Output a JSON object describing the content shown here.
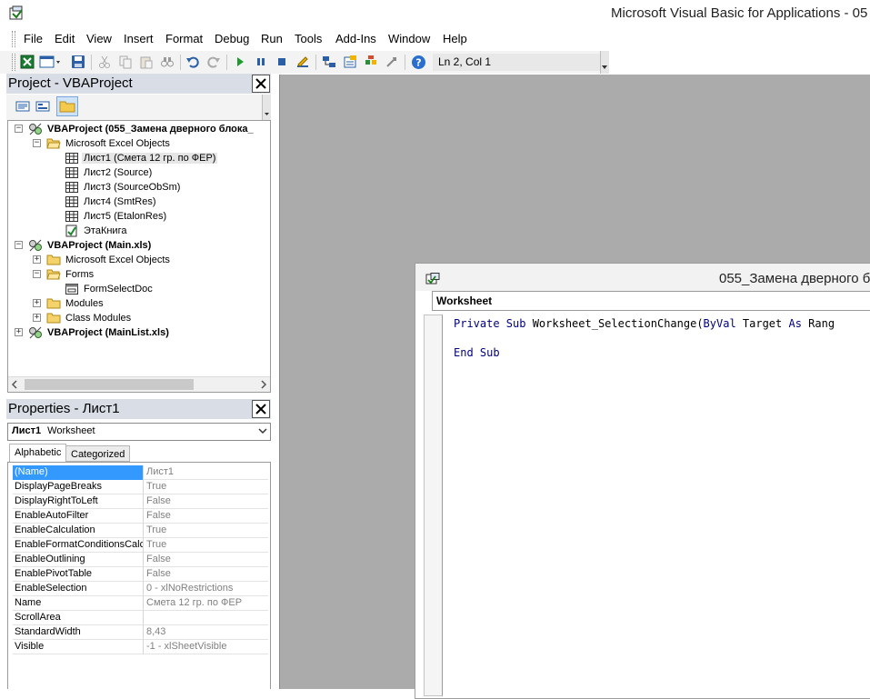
{
  "window": {
    "title": "Microsoft Visual Basic for Applications - 05"
  },
  "menu": {
    "items": [
      "File",
      "Edit",
      "View",
      "Insert",
      "Format",
      "Debug",
      "Run",
      "Tools",
      "Add-Ins",
      "Window",
      "Help"
    ]
  },
  "toolbar": {
    "position": "Ln 2, Col 1",
    "icons": [
      "excel-view-icon",
      "insert-form-icon",
      "save-icon",
      "cut-icon",
      "copy-icon",
      "paste-icon",
      "find-icon",
      "undo-icon",
      "redo-icon",
      "run-icon",
      "break-icon",
      "reset-icon",
      "design-mode-icon",
      "project-explorer-icon",
      "properties-window-icon",
      "object-browser-icon",
      "toolbox-icon",
      "help-icon"
    ]
  },
  "project_panel": {
    "title": "Project - VBAProject",
    "tree": [
      {
        "label": "VBAProject (055_Замена дверного блока_",
        "level": 0,
        "expander": "−",
        "icon": "vba-project-icon",
        "bold": true
      },
      {
        "label": "Microsoft Excel Objects",
        "level": 1,
        "expander": "−",
        "icon": "folder-open-icon",
        "bold": false
      },
      {
        "label": "Лист1 (Смета 12 гр. по ФЕР)",
        "level": 2,
        "expander": "",
        "icon": "sheet-icon",
        "bold": false,
        "selected": true
      },
      {
        "label": "Лист2 (Source)",
        "level": 2,
        "expander": "",
        "icon": "sheet-icon",
        "bold": false
      },
      {
        "label": "Лист3 (SourceObSm)",
        "level": 2,
        "expander": "",
        "icon": "sheet-icon",
        "bold": false
      },
      {
        "label": "Лист4 (SmtRes)",
        "level": 2,
        "expander": "",
        "icon": "sheet-icon",
        "bold": false
      },
      {
        "label": "Лист5 (EtalonRes)",
        "level": 2,
        "expander": "",
        "icon": "sheet-icon",
        "bold": false
      },
      {
        "label": "ЭтаКнига",
        "level": 2,
        "expander": "",
        "icon": "workbook-icon",
        "bold": false
      },
      {
        "label": "VBAProject (Main.xls)",
        "level": 0,
        "expander": "−",
        "icon": "vba-project-icon",
        "bold": true
      },
      {
        "label": "Microsoft Excel Objects",
        "level": 1,
        "expander": "+",
        "icon": "folder-icon",
        "bold": false
      },
      {
        "label": "Forms",
        "level": 1,
        "expander": "−",
        "icon": "folder-open-icon",
        "bold": false
      },
      {
        "label": "FormSelectDoc",
        "level": 2,
        "expander": "",
        "icon": "form-icon",
        "bold": false
      },
      {
        "label": "Modules",
        "level": 1,
        "expander": "+",
        "icon": "folder-icon",
        "bold": false
      },
      {
        "label": "Class Modules",
        "level": 1,
        "expander": "+",
        "icon": "folder-icon",
        "bold": false
      },
      {
        "label": "VBAProject (MainList.xls)",
        "level": 0,
        "expander": "+",
        "icon": "vba-project-icon",
        "bold": true
      }
    ]
  },
  "properties_panel": {
    "title": "Properties - Лист1",
    "object_name": "Лист1",
    "object_type": "Worksheet",
    "tabs": [
      "Alphabetic",
      "Categorized"
    ],
    "rows": [
      {
        "name": "(Name)",
        "value": "Лист1",
        "selected": true
      },
      {
        "name": "DisplayPageBreaks",
        "value": "True"
      },
      {
        "name": "DisplayRightToLeft",
        "value": "False"
      },
      {
        "name": "EnableAutoFilter",
        "value": "False"
      },
      {
        "name": "EnableCalculation",
        "value": "True"
      },
      {
        "name": "EnableFormatConditionsCalcu",
        "value": "True"
      },
      {
        "name": "EnableOutlining",
        "value": "False"
      },
      {
        "name": "EnablePivotTable",
        "value": "False"
      },
      {
        "name": "EnableSelection",
        "value": "0 - xlNoRestrictions"
      },
      {
        "name": "Name",
        "value": "Смета 12 гр. по ФЕР"
      },
      {
        "name": "ScrollArea",
        "value": ""
      },
      {
        "name": "StandardWidth",
        "value": "8,43"
      },
      {
        "name": "Visible",
        "value": "-1 - xlSheetVisible"
      }
    ]
  },
  "code_window": {
    "title": "055_Замена дверного б",
    "object_combo": "Worksheet",
    "line1": {
      "kw1": "Private Sub ",
      "name": "Worksheet_SelectionChange(",
      "kw2": "ByVal",
      "rest": " Target ",
      "kw3": "As",
      "tail": " Rang"
    },
    "line3": "End Sub"
  }
}
